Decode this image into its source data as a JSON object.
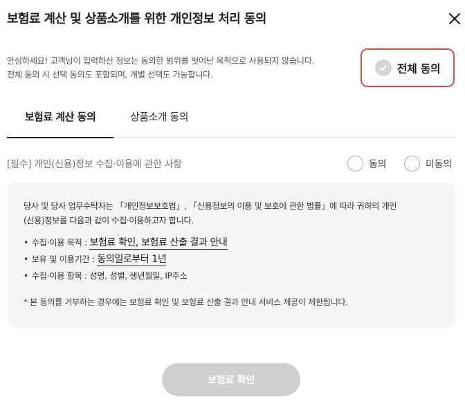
{
  "header": {
    "title": "보험료 계산 및 상품소개를 위한 개인정보 처리 동의",
    "close_icon": "close-icon"
  },
  "intro": {
    "line1": "안심하세요! 고객님이 입력하신 정보는 동의한 범위를 벗어난 목적으로 사용되지 않습니다.",
    "line2": "전체 동의 시 선택 동의도 포함되며, 개별 선택도 가능합니다."
  },
  "all_agree": {
    "label": "전체 동의",
    "checked": false,
    "border_color": "#d9513c",
    "icon": "check-circle-icon"
  },
  "tabs": [
    {
      "label": "보험료 계산 동의",
      "active": true
    },
    {
      "label": "상품소개 동의",
      "active": false
    }
  ],
  "section": {
    "title": "[필수] 개인(신용)정보 수집·이용에 관한 사항",
    "options": [
      {
        "label": "동의",
        "selected": false
      },
      {
        "label": "미동의",
        "selected": false
      }
    ]
  },
  "details": {
    "desc_line1": "당사 및 당사 업무수탁자는 「개인정보보호법」, 「신용정보의 이용 및 보호에 관한 법률」에 따라 귀하의 개인",
    "desc_line2": "(신용)정보를 다음과 같이 수집·이용하고자 합니다.",
    "items": [
      {
        "label": "수집·이용 목적 : ",
        "value": "보험료 확인, 보험료 산출 결과 안내"
      },
      {
        "label": "보유 및 이용기간 : ",
        "value": "동의일로부터 1년"
      },
      {
        "label": "수집·이용 항목 : ",
        "value": "성명, 성별, 생년월일, IP주소"
      }
    ],
    "note": "* 본 동의를 거부하는 경우에는 보험료 확인 및 보험료 산출 결과 안내 서비스 제공이 제한됩니다."
  },
  "confirm_button": {
    "label": "보험료 확인",
    "enabled": false,
    "background": "#cfcfcf"
  }
}
